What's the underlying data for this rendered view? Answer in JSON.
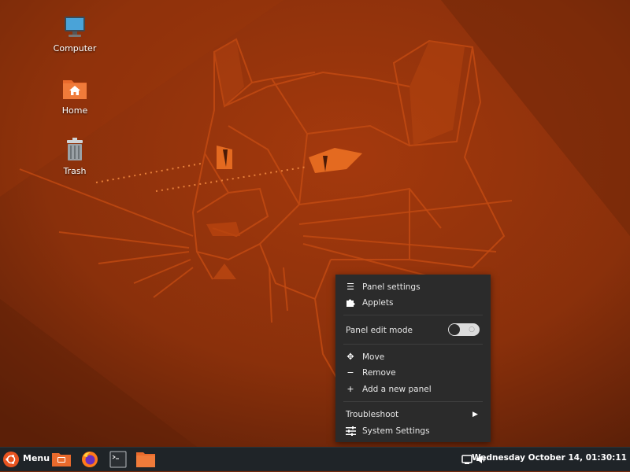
{
  "desktop": {
    "icons": [
      {
        "label": "Computer",
        "icon": "computer-icon"
      },
      {
        "label": "Home",
        "icon": "home-folder-icon"
      },
      {
        "label": "Trash",
        "icon": "trash-icon"
      }
    ]
  },
  "context_menu": {
    "items": [
      {
        "label": "Panel settings",
        "icon": "hamburger-icon"
      },
      {
        "label": "Applets",
        "icon": "puzzle-icon"
      },
      {
        "label": "Panel edit mode",
        "icon": "",
        "toggle_on": false
      },
      {
        "label": "Move",
        "icon": "move-icon"
      },
      {
        "label": "Remove",
        "icon": "minus-icon"
      },
      {
        "label": "Add a new panel",
        "icon": "plus-icon"
      },
      {
        "label": "Troubleshoot",
        "icon": "",
        "submenu": true
      },
      {
        "label": "System Settings",
        "icon": "sliders-icon"
      }
    ]
  },
  "taskbar": {
    "menu_label": "Menu",
    "launchers": [
      "show-desktop-icon",
      "firefox-icon",
      "terminal-icon",
      "file-manager-icon"
    ],
    "clock": "Wednesday October 14, 01:30:11",
    "tray": [
      "network-icon",
      "volume-icon"
    ]
  },
  "colors": {
    "accent": "#e95420",
    "menu_bg": "#2b2b2b",
    "panel_bg": "#1f2428"
  }
}
